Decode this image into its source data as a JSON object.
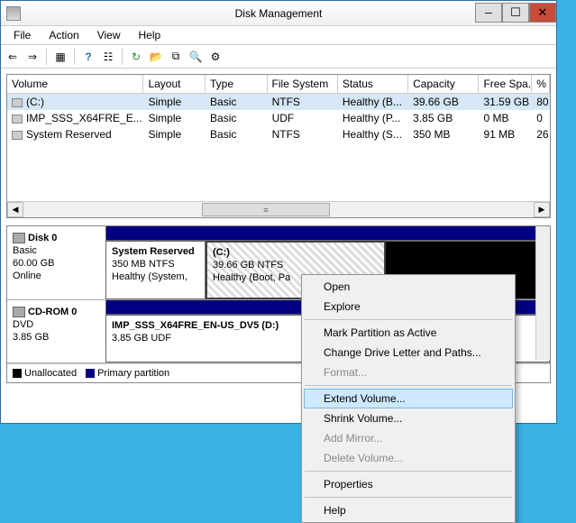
{
  "window": {
    "title": "Disk Management",
    "min": "—",
    "max": "☐",
    "close": "✕"
  },
  "menu": {
    "file": "File",
    "action": "Action",
    "view": "View",
    "help": "Help"
  },
  "columns": {
    "vol": "Volume",
    "lay": "Layout",
    "type": "Type",
    "fs": "File System",
    "stat": "Status",
    "cap": "Capacity",
    "free": "Free Spa...",
    "pct": "%"
  },
  "volumes": [
    {
      "name": "(C:)",
      "layout": "Simple",
      "type": "Basic",
      "fs": "NTFS",
      "status": "Healthy (B...",
      "cap": "39.66 GB",
      "free": "31.59 GB",
      "pct": "80"
    },
    {
      "name": "IMP_SSS_X64FRE_E...",
      "layout": "Simple",
      "type": "Basic",
      "fs": "UDF",
      "status": "Healthy (P...",
      "cap": "3.85 GB",
      "free": "0 MB",
      "pct": "0"
    },
    {
      "name": "System Reserved",
      "layout": "Simple",
      "type": "Basic",
      "fs": "NTFS",
      "status": "Healthy (S...",
      "cap": "350 MB",
      "free": "91 MB",
      "pct": "26"
    }
  ],
  "disk0": {
    "title": "Disk 0",
    "type": "Basic",
    "size": "60.00 GB",
    "status": "Online",
    "p1_name": "System Reserved",
    "p1_size": "350 MB NTFS",
    "p1_stat": "Healthy (System,",
    "p2_name": "(C:)",
    "p2_size": "39.66 GB NTFS",
    "p2_stat": "Healthy (Boot, Pa"
  },
  "cdrom": {
    "title": "CD-ROM 0",
    "type": "DVD",
    "size": "3.85 GB",
    "p1_name": "IMP_SSS_X64FRE_EN-US_DV5  (D:)",
    "p1_size": "3.85 GB UDF"
  },
  "legend": {
    "unalloc": "Unallocated",
    "primary": "Primary partition"
  },
  "ctx": {
    "open": "Open",
    "explore": "Explore",
    "mark": "Mark Partition as Active",
    "change": "Change Drive Letter and Paths...",
    "format": "Format...",
    "extend": "Extend Volume...",
    "shrink": "Shrink Volume...",
    "mirror": "Add Mirror...",
    "delete": "Delete Volume...",
    "props": "Properties",
    "help": "Help"
  }
}
